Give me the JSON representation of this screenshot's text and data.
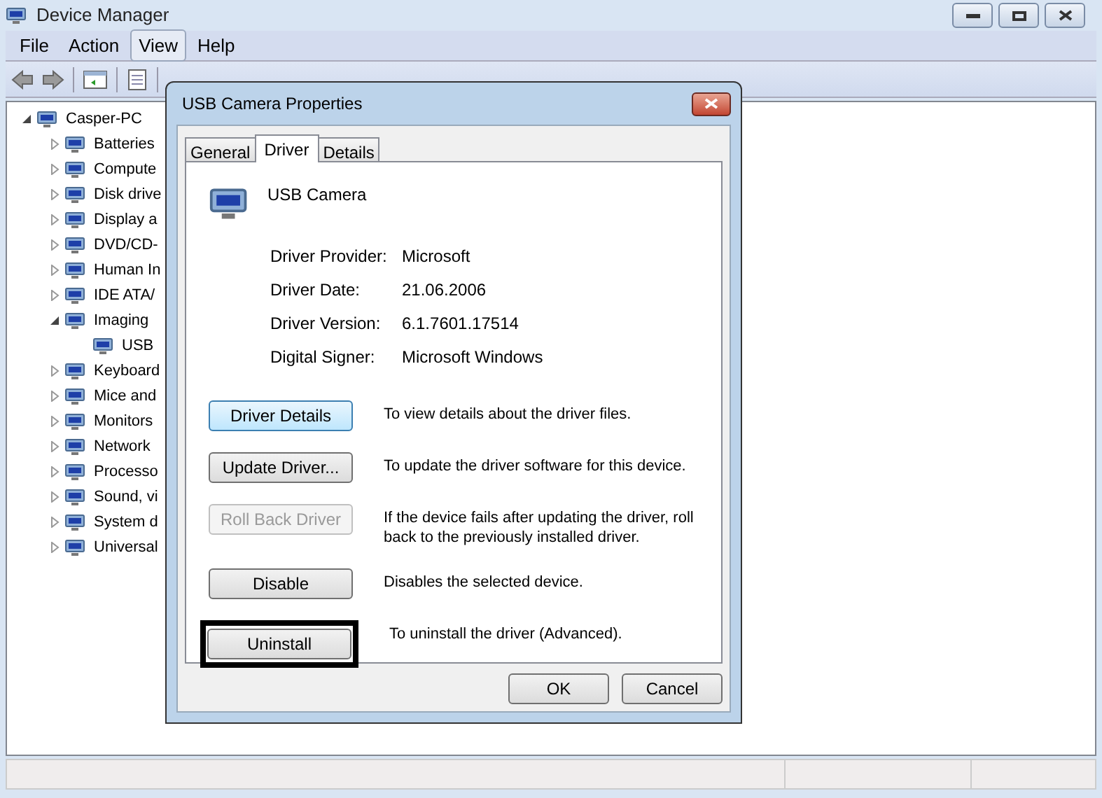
{
  "window": {
    "title": "Device Manager"
  },
  "menu": [
    {
      "label": "File",
      "selected": false
    },
    {
      "label": "Action",
      "selected": false
    },
    {
      "label": "View",
      "selected": true
    },
    {
      "label": "Help",
      "selected": false
    }
  ],
  "tree": [
    {
      "label": "Casper-PC",
      "expanded": true,
      "children": [
        {
          "label": "Batteries",
          "expanded": false
        },
        {
          "label": "Compute",
          "expanded": false
        },
        {
          "label": "Disk drive",
          "expanded": false
        },
        {
          "label": "Display a",
          "expanded": false
        },
        {
          "label": "DVD/CD-",
          "expanded": false
        },
        {
          "label": "Human In",
          "expanded": false
        },
        {
          "label": "IDE ATA/",
          "expanded": false
        },
        {
          "label": "Imaging",
          "expanded": true,
          "children": [
            {
              "label": "USB"
            }
          ]
        },
        {
          "label": "Keyboard",
          "expanded": false
        },
        {
          "label": "Mice and",
          "expanded": false
        },
        {
          "label": "Monitors",
          "expanded": false
        },
        {
          "label": "Network",
          "expanded": false
        },
        {
          "label": "Processo",
          "expanded": false
        },
        {
          "label": "Sound, vi",
          "expanded": false
        },
        {
          "label": "System d",
          "expanded": false
        },
        {
          "label": "Universal",
          "expanded": false
        }
      ]
    }
  ],
  "dialog": {
    "title": "USB Camera Properties",
    "tabs": [
      {
        "label": "General",
        "selected": false
      },
      {
        "label": "Driver",
        "selected": true
      },
      {
        "label": "Details",
        "selected": false
      }
    ],
    "device_name": "USB Camera",
    "properties": [
      {
        "label": "Driver Provider:",
        "value": "Microsoft"
      },
      {
        "label": "Driver Date:",
        "value": "21.06.2006"
      },
      {
        "label": "Driver Version:",
        "value": "6.1.7601.17514"
      },
      {
        "label": "Digital Signer:",
        "value": "Microsoft Windows"
      }
    ],
    "actions": [
      {
        "button": "Driver Details",
        "description": "To view details about the driver files.",
        "disabled": false,
        "default": true,
        "highlighted": false
      },
      {
        "button": "Update Driver...",
        "description": "To update the driver software for this device.",
        "disabled": false,
        "default": false,
        "highlighted": false
      },
      {
        "button": "Roll Back Driver",
        "description": "If the device fails after updating the driver, roll back to the previously installed driver.",
        "disabled": true,
        "default": false,
        "highlighted": false
      },
      {
        "button": "Disable",
        "description": "Disables the selected device.",
        "disabled": false,
        "default": false,
        "highlighted": false
      },
      {
        "button": "Uninstall",
        "description": "To uninstall the driver (Advanced).",
        "disabled": false,
        "default": false,
        "highlighted": true
      }
    ],
    "buttons": [
      "OK",
      "Cancel"
    ]
  }
}
